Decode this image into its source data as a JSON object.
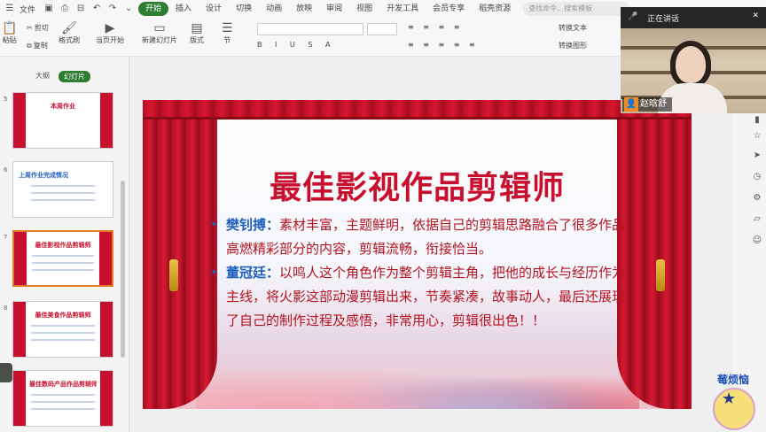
{
  "menubar": {
    "file": "文件",
    "tabs": [
      "开始",
      "插入",
      "设计",
      "切换",
      "动画",
      "放映",
      "审阅",
      "视图",
      "开发工具",
      "会员专享",
      "稻壳资源"
    ],
    "active_tab": "开始",
    "search_placeholder": "查找命令、搜索模板"
  },
  "ribbon": {
    "paste": "粘贴",
    "cut": "剪切",
    "copy": "复制",
    "format_painter": "格式刷",
    "from_start": "当页开始",
    "new_slide": "新建幻灯片",
    "layout": "版式",
    "section": "节",
    "convert_text": "转换文本",
    "convert_shape": "转换图形"
  },
  "panel": {
    "tab_outline": "大纲",
    "tab_slides": "幻灯片",
    "thumbs": [
      {
        "num": "5",
        "title": "本周作业"
      },
      {
        "num": "6",
        "title": "上周作业完成情况"
      },
      {
        "num": "7",
        "title": "最佳影视作品剪辑师"
      },
      {
        "num": "8",
        "title": "最佳美食作品剪辑师"
      },
      {
        "num": "9",
        "title": "最佳数码产品作品剪辑师"
      }
    ]
  },
  "slide": {
    "title": "最佳影视作品剪辑师",
    "bullets": [
      {
        "name": "樊钊搏：",
        "text": "素材丰富，主题鲜明，依据自己的剪辑思路融合了很多作品高燃精彩部分的内容，剪辑流畅，衔接恰当。"
      },
      {
        "name": "董冠廷：",
        "text": "以鸣人这个角色作为整个剪辑主角，把他的成长与经历作为主线，将火影这部动漫剪辑出来，节奏紧凑，故事动人，最后还展现了自己的制作过程及感悟，非常用心，剪辑很出色！！"
      }
    ],
    "colors": {
      "title": "#c8102e",
      "body": "#b4121f",
      "name": "#1f5fbf",
      "curtain": "#c8102e"
    }
  },
  "camera": {
    "status": "正在讲话",
    "user_name": "赵晗舒"
  },
  "sticker": {
    "text": "莓烦恼"
  }
}
